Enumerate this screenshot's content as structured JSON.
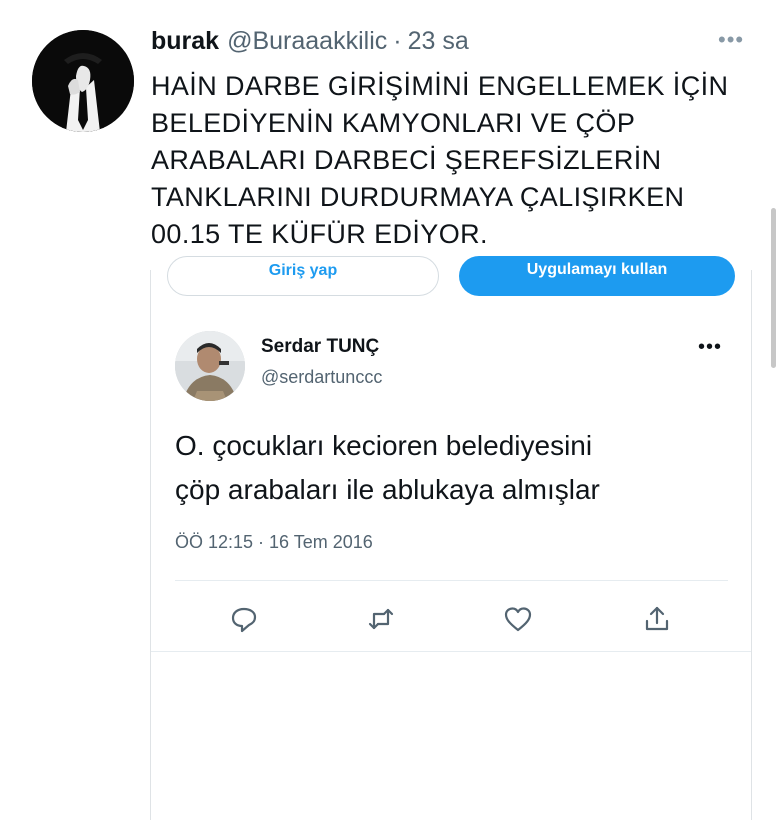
{
  "tweet": {
    "author_name": "burak",
    "author_handle": "@Buraaakkilic",
    "separator": "·",
    "time_ago": "23 sa",
    "more": "•••",
    "text_lines": [
      "HAİN DARBE GİRİŞİMİNİ ENGELLEMEK İÇİN",
      "BELEDİYENİN KAMYONLARI VE ÇÖP",
      "ARABALARI DARBECİ ŞEREFSİZLERİN",
      "TANKLARINI DURDURMAYA ÇALIŞIRKEN",
      "00.15 TE KÜFÜR EDİYOR."
    ]
  },
  "embed": {
    "login_label": "Giriş yap",
    "app_label": "Uygulamayı kullan",
    "accent_color": "#1d9bf0",
    "quoted": {
      "name": "Serdar TUNÇ",
      "handle": "@serdartunccc",
      "more": "•••",
      "text_lines": [
        "O. çocukları kecioren belediyesini",
        "çöp arabaları ile ablukaya almışlar"
      ],
      "timestamp": "ÖÖ 12:15 · 16 Tem 2016"
    },
    "actions": [
      "reply-icon",
      "retweet-icon",
      "like-icon",
      "share-icon"
    ]
  }
}
